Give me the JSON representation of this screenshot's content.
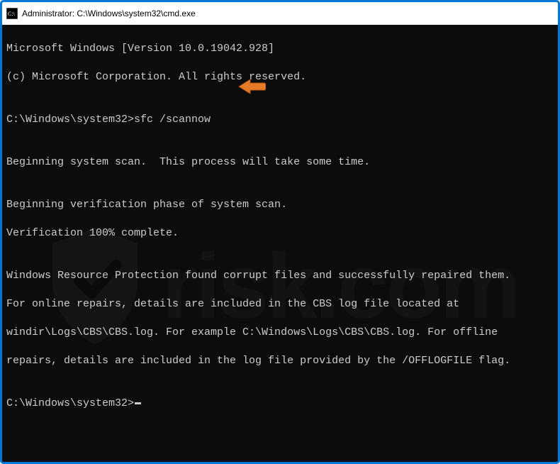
{
  "window": {
    "title": "Administrator: C:\\Windows\\system32\\cmd.exe"
  },
  "terminal": {
    "line1": "Microsoft Windows [Version 10.0.19042.928]",
    "line2": "(c) Microsoft Corporation. All rights reserved.",
    "blank1": "",
    "prompt1_path": "C:\\Windows\\system32>",
    "prompt1_cmd": "sfc /scannow",
    "blank2": "",
    "line3": "Beginning system scan.  This process will take some time.",
    "blank3": "",
    "line4": "Beginning verification phase of system scan.",
    "line5": "Verification 100% complete.",
    "blank4": "",
    "line6": "Windows Resource Protection found corrupt files and successfully repaired them.",
    "line7": "For online repairs, details are included in the CBS log file located at",
    "line8": "windir\\Logs\\CBS\\CBS.log. For example C:\\Windows\\Logs\\CBS\\CBS.log. For offline",
    "line9": "repairs, details are included in the log file provided by the /OFFLOGFILE flag.",
    "blank5": "",
    "prompt2_path": "C:\\Windows\\system32>"
  },
  "annotation": {
    "arrow_color": "#e67a27"
  },
  "watermark": {
    "text": "risk.com"
  }
}
